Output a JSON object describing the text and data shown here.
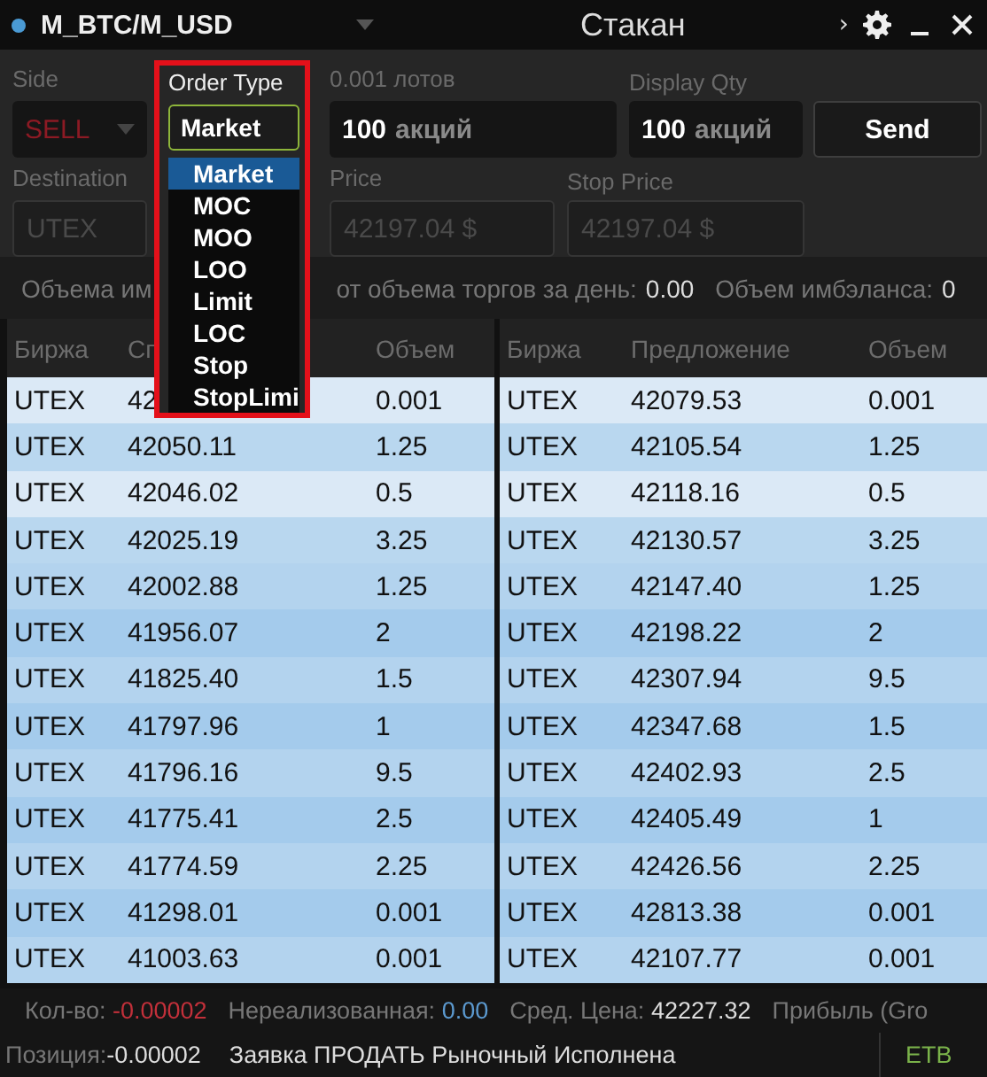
{
  "title_bar": {
    "symbol": "M_BTC/M_USD",
    "title": "Стакан",
    "overflow_glyph": "›"
  },
  "order_form": {
    "side": {
      "label": "Side",
      "value": "SELL"
    },
    "quantity": {
      "label": "0.001 лотов",
      "number": "100",
      "unit": "акций"
    },
    "display_qty": {
      "label": "Display Qty",
      "number": "100",
      "unit": "акций"
    },
    "send_button": "Send",
    "destination": {
      "label": "Destination",
      "value": "UTEX",
      "disabled": true
    },
    "price": {
      "label": "Price",
      "value": "42197.04 $",
      "disabled": true
    },
    "stop_price": {
      "label": "Stop Price",
      "value": "42197.04 $",
      "disabled": true
    }
  },
  "order_type": {
    "label": "Order Type",
    "value": "Market",
    "options": [
      {
        "label": "Market",
        "selected": true
      },
      {
        "label": "MOC",
        "selected": false
      },
      {
        "label": "MOO",
        "selected": false
      },
      {
        "label": "LOO",
        "selected": false
      },
      {
        "label": "Limit",
        "selected": false
      },
      {
        "label": "LOC",
        "selected": false
      },
      {
        "label": "Stop",
        "selected": false
      },
      {
        "label": "StopLimi",
        "selected": false
      }
    ]
  },
  "imbalance_line": {
    "part_1": "Объема им",
    "part_2": "от объема торгов за день:",
    "value_2": "0.00",
    "label_3": "Объем имбэланса:",
    "value_3": "0"
  },
  "bids": {
    "columns": [
      "Биржа",
      "Сп",
      "Объем"
    ],
    "rows": [
      [
        "UTEX",
        "42",
        "0.001"
      ],
      [
        "UTEX",
        "42050.11",
        "1.25"
      ],
      [
        "UTEX",
        "42046.02",
        "0.5"
      ],
      [
        "UTEX",
        "42025.19",
        "3.25"
      ],
      [
        "UTEX",
        "42002.88",
        "1.25"
      ],
      [
        "UTEX",
        "41956.07",
        "2"
      ],
      [
        "UTEX",
        "41825.40",
        "1.5"
      ],
      [
        "UTEX",
        "41797.96",
        "1"
      ],
      [
        "UTEX",
        "41796.16",
        "9.5"
      ],
      [
        "UTEX",
        "41775.41",
        "2.5"
      ],
      [
        "UTEX",
        "41774.59",
        "2.25"
      ],
      [
        "UTEX",
        "41298.01",
        "0.001"
      ],
      [
        "UTEX",
        "41003.63",
        "0.001"
      ]
    ]
  },
  "asks": {
    "columns": [
      "Биржа",
      "Предложение",
      "Объем"
    ],
    "rows": [
      [
        "UTEX",
        "42079.53",
        "0.001"
      ],
      [
        "UTEX",
        "42105.54",
        "1.25"
      ],
      [
        "UTEX",
        "42118.16",
        "0.5"
      ],
      [
        "UTEX",
        "42130.57",
        "3.25"
      ],
      [
        "UTEX",
        "42147.40",
        "1.25"
      ],
      [
        "UTEX",
        "42198.22",
        "2"
      ],
      [
        "UTEX",
        "42307.94",
        "9.5"
      ],
      [
        "UTEX",
        "42347.68",
        "1.5"
      ],
      [
        "UTEX",
        "42402.93",
        "2.5"
      ],
      [
        "UTEX",
        "42405.49",
        "1"
      ],
      [
        "UTEX",
        "42426.56",
        "2.25"
      ],
      [
        "UTEX",
        "42813.38",
        "0.001"
      ],
      [
        "UTEX",
        "42107.77",
        "0.001"
      ]
    ]
  },
  "status_bar": {
    "stats": [
      {
        "label": "Кол-во:",
        "value": "-0.00002",
        "kind": "negative"
      },
      {
        "label": "Нереализованная:",
        "value": "0.00",
        "kind": "neutral"
      },
      {
        "label": "Сред. Цена:",
        "value": "42227.32",
        "kind": "plain"
      },
      {
        "label": "Прибыль (Gro"
      }
    ],
    "position": {
      "label": "Позиция:",
      "value": "-0.00002"
    },
    "message": "Заявка ПРОДАТЬ Рыночный Исполнена",
    "account": "ETB"
  }
}
